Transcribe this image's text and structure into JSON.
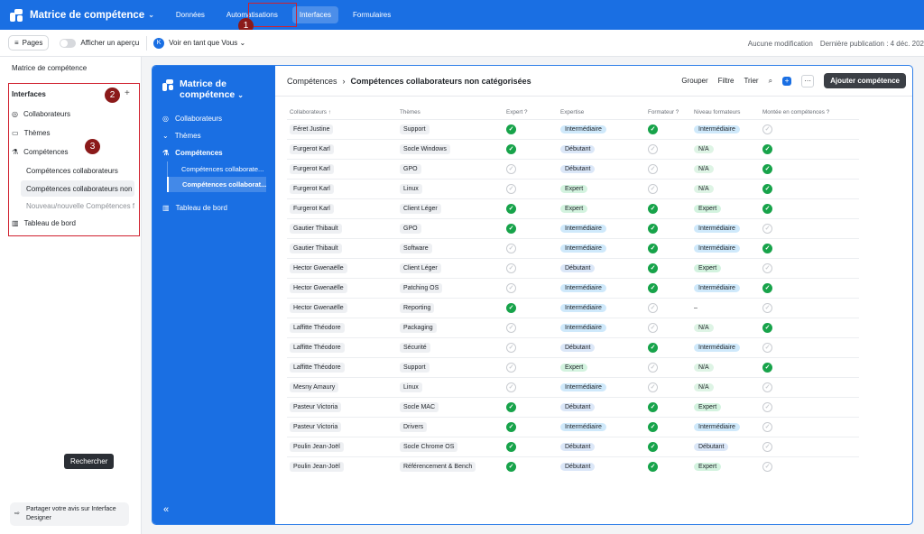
{
  "app": {
    "title": "Matrice de compétence"
  },
  "nav": [
    "Données",
    "Automatisations",
    "Interfaces",
    "Formulaires"
  ],
  "subbar": {
    "pages_label": "Pages",
    "preview_label": "Afficher un aperçu",
    "view_as": "Voir en tant que Vous",
    "avatar_letter": "K",
    "status": "Aucune modification",
    "publish": "Dernière publication : 4 déc. 202"
  },
  "sidebar": {
    "title": "Matrice de compétence",
    "section": "Interfaces",
    "items": [
      "Collaborateurs",
      "Thèmes",
      "Compétences"
    ],
    "subitems": [
      "Compétences collaborateurs",
      "Compétences collaborateurs non c",
      "Nouveau/nouvelle Compétences fc"
    ],
    "dashboard": "Tableau de bord",
    "share_line1": "Partager votre avis sur Interface",
    "share_line2": "Designer",
    "tooltip": "Rechercher"
  },
  "annotations": [
    "1",
    "2",
    "3"
  ],
  "interface": {
    "title_line1": "Matrice de",
    "title_line2": "compétence",
    "items": [
      "Collaborateurs",
      "Thèmes",
      "Compétences"
    ],
    "subitems": [
      "Compétences collaborate...",
      "Compétences collaborat..."
    ],
    "dashboard": "Tableau de bord",
    "collapse": "«"
  },
  "content": {
    "breadcrumb_parent": "Compétences",
    "breadcrumb_current": "Compétences collaborateurs non catégorisées",
    "toolbar": {
      "group": "Grouper",
      "filter": "Filtre",
      "sort": "Trier",
      "add": "Ajouter compétence"
    },
    "columns": [
      "Collaborateurs ↑",
      "Thèmes",
      "Expert ?",
      "Expertise",
      "Formateur ?",
      "Niveau formateurs",
      "Montée en compétences ?"
    ],
    "rows": [
      {
        "name": "Féret Justine",
        "theme": "Support",
        "expert": true,
        "expertise": "Intermédiaire",
        "formateur": true,
        "niveau": "Intermédiaire",
        "montee": false
      },
      {
        "name": "Furgerot Karl",
        "theme": "Socle Windows",
        "expert": true,
        "expertise": "Débutant",
        "formateur": false,
        "niveau": "N/A",
        "montee": true
      },
      {
        "name": "Furgerot Karl",
        "theme": "GPO",
        "expert": false,
        "expertise": "Débutant",
        "formateur": false,
        "niveau": "N/A",
        "montee": true
      },
      {
        "name": "Furgerot Karl",
        "theme": "Linux",
        "expert": false,
        "expertise": "Expert",
        "formateur": false,
        "niveau": "N/A",
        "montee": true
      },
      {
        "name": "Furgerot Karl",
        "theme": "Client Léger",
        "expert": true,
        "expertise": "Expert",
        "formateur": true,
        "niveau": "Expert",
        "montee": true
      },
      {
        "name": "Gautier Thibault",
        "theme": "GPO",
        "expert": true,
        "expertise": "Intermédiaire",
        "formateur": true,
        "niveau": "Intermédiaire",
        "montee": false
      },
      {
        "name": "Gautier Thibault",
        "theme": "Software",
        "expert": false,
        "expertise": "Intermédiaire",
        "formateur": true,
        "niveau": "Intermédiaire",
        "montee": true
      },
      {
        "name": "Hector Gwenaëlle",
        "theme": "Client Léger",
        "expert": false,
        "expertise": "Débutant",
        "formateur": true,
        "niveau": "Expert",
        "montee": false
      },
      {
        "name": "Hector Gwenaëlle",
        "theme": "Patching OS",
        "expert": false,
        "expertise": "Intermédiaire",
        "formateur": true,
        "niveau": "Intermédiaire",
        "montee": true
      },
      {
        "name": "Hector Gwenaëlle",
        "theme": "Reporting",
        "expert": true,
        "expertise": "Intermédiaire",
        "formateur": false,
        "niveau": "–",
        "montee": false
      },
      {
        "name": "Laffitte Théodore",
        "theme": "Packaging",
        "expert": false,
        "expertise": "Intermédiaire",
        "formateur": false,
        "niveau": "N/A",
        "montee": true
      },
      {
        "name": "Laffitte Théodore",
        "theme": "Sécurité",
        "expert": false,
        "expertise": "Débutant",
        "formateur": true,
        "niveau": "Intermédiaire",
        "montee": false
      },
      {
        "name": "Laffitte Théodore",
        "theme": "Support",
        "expert": false,
        "expertise": "Expert",
        "formateur": false,
        "niveau": "N/A",
        "montee": true
      },
      {
        "name": "Mesny Amaury",
        "theme": "Linux",
        "expert": false,
        "expertise": "Intermédiaire",
        "formateur": false,
        "niveau": "N/A",
        "montee": false
      },
      {
        "name": "Pasteur Victoria",
        "theme": "Socle MAC",
        "expert": true,
        "expertise": "Débutant",
        "formateur": true,
        "niveau": "Expert",
        "montee": false
      },
      {
        "name": "Pasteur Victoria",
        "theme": "Drivers",
        "expert": true,
        "expertise": "Intermédiaire",
        "formateur": true,
        "niveau": "Intermédiaire",
        "montee": false
      },
      {
        "name": "Poulin Jean-Joël",
        "theme": "Socle Chrome OS",
        "expert": true,
        "expertise": "Débutant",
        "formateur": true,
        "niveau": "Débutant",
        "montee": false
      },
      {
        "name": "Poulin Jean-Joël",
        "theme": "Référencement & Bench",
        "expert": true,
        "expertise": "Débutant",
        "formateur": true,
        "niveau": "Expert",
        "montee": false
      }
    ]
  },
  "colors": {
    "brand": "#1a6fe3",
    "check": "#17a34a",
    "annotation": "#d0202e"
  }
}
